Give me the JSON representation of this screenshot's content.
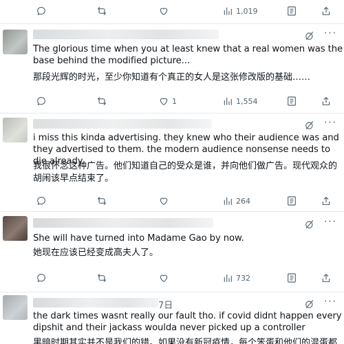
{
  "top_actions": {
    "views": "1,019"
  },
  "comments": [
    {
      "text_en": "The glorious time when you at least knew that a real women was the base behind the modified picture...",
      "text_zh": "那段光辉的时光，至少你知道有个真正的女人是这张修改版的基础……",
      "likes": "1",
      "views": "1,554"
    },
    {
      "text_en": "i miss this kinda advertising. they knew who their audience was and they advertised to them. the modern audience nonsense needs to die already.",
      "text_zh": "我很怀念这种广告。他们知道自己的受众是谁，并向他们做广告。现代观众的胡闹该早点结束了。",
      "views": "264"
    },
    {
      "text_en": "She will have turned into Madame Gao by now.",
      "text_zh": "她现在应该已经变成高夫人了。",
      "views": "732"
    },
    {
      "date_fragment": "7日",
      "text_en": "the dark times wasnt really our fault tho. if covid didnt happen every dipshit and their jackass woulda never picked up a controller",
      "text_zh": "黑暗时期其实并不是我们的错。如果没有新冠疫情，每个笨蛋和他们的混蛋都"
    }
  ],
  "icons": {
    "reply": "reply-icon",
    "retweet": "retweet-icon",
    "like": "heart-icon",
    "views": "views-icon",
    "bookmark": "bookmark-icon",
    "share": "share-icon",
    "grok": "grok-icon",
    "more": "more-icon"
  },
  "colors": {
    "text": "#0f1419",
    "secondary": "#536471",
    "divider": "#e7e9ea",
    "background": "#ffffff"
  }
}
